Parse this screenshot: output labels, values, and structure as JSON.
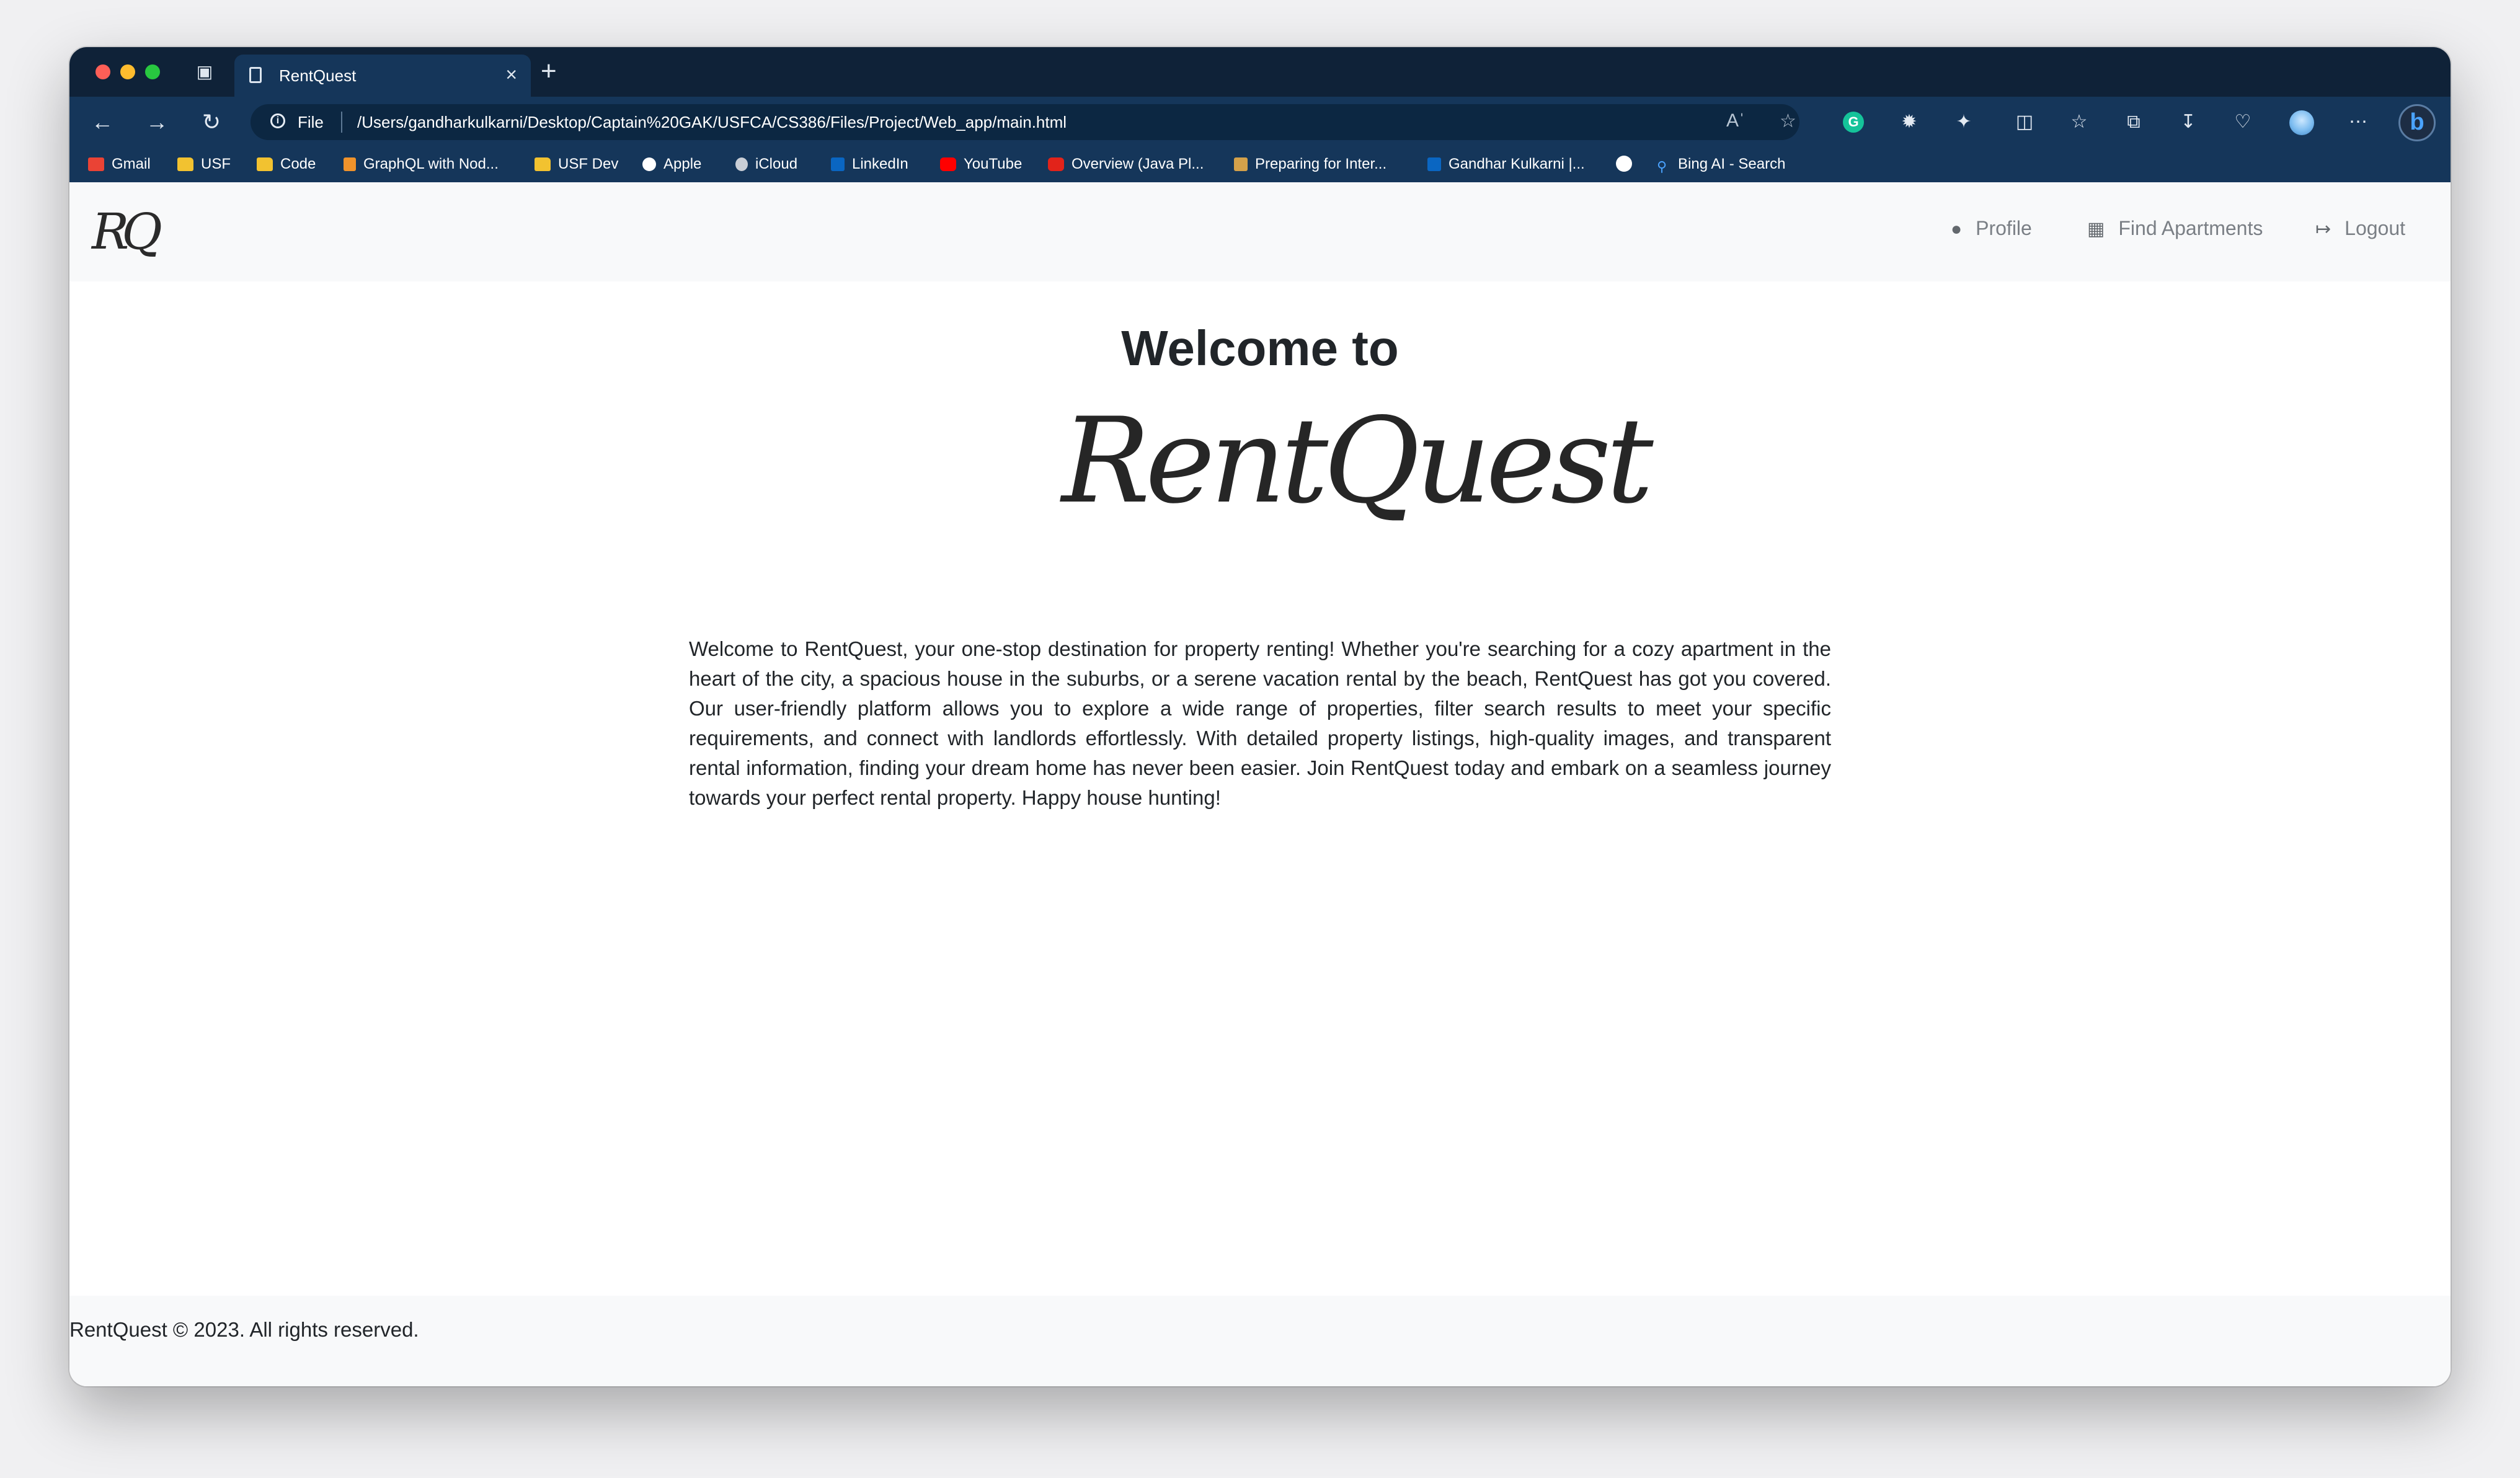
{
  "browser": {
    "tab": {
      "title": "RentQuest"
    },
    "address": {
      "scheme_label": "File",
      "url": "/Users/gandharkulkarni/Desktop/Captain%20GAK/USFCA/CS386/Files/Project/Web_app/main.html"
    },
    "bookmarks": [
      {
        "label": "Gmail"
      },
      {
        "label": "USF"
      },
      {
        "label": "Code"
      },
      {
        "label": "GraphQL with Nod..."
      },
      {
        "label": "USF Dev"
      },
      {
        "label": "Apple"
      },
      {
        "label": "iCloud"
      },
      {
        "label": "LinkedIn"
      },
      {
        "label": "YouTube"
      },
      {
        "label": "Overview (Java Pl..."
      },
      {
        "label": "Preparing for Inter..."
      },
      {
        "label": "Gandhar Kulkarni |..."
      },
      {
        "label": ""
      },
      {
        "label": "Bing AI - Search"
      }
    ]
  },
  "site": {
    "brand_logo": "RQ",
    "nav": [
      {
        "label": "Profile",
        "icon": "user-circle-icon"
      },
      {
        "label": "Find Apartments",
        "icon": "building-icon"
      },
      {
        "label": "Logout",
        "icon": "logout-icon"
      }
    ],
    "hero": {
      "title": "Welcome to",
      "logo_text": "RentQuest",
      "intro": "Welcome to RentQuest, your one-stop destination for property renting! Whether you're searching for a cozy apartment in the heart of the city, a spacious house in the suburbs, or a serene vacation rental by the beach, RentQuest has got you covered. Our user-friendly platform allows you to explore a wide range of properties, filter search results to meet your specific requirements, and connect with landlords effortlessly. With detailed property listings, high-quality images, and transparent rental information, finding your dream home has never been easier. Join RentQuest today and embark on a seamless journey towards your perfect rental property. Happy house hunting!"
    },
    "footer": {
      "text": "RentQuest © 2023. All rights reserved."
    }
  }
}
